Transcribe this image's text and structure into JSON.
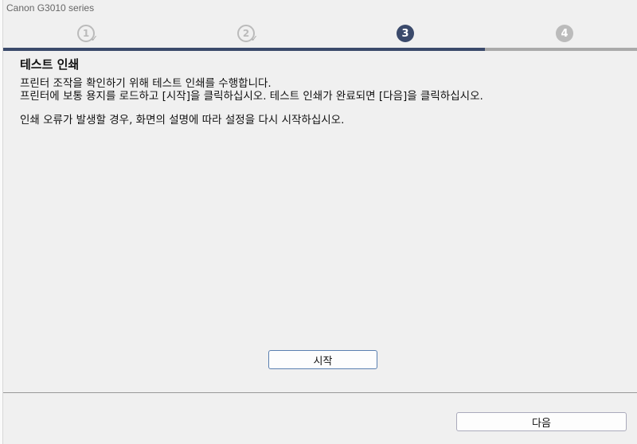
{
  "window": {
    "title": "Canon G3010 series"
  },
  "steps": [
    {
      "label": "1",
      "state": "done"
    },
    {
      "label": "2",
      "state": "done"
    },
    {
      "label": "3",
      "state": "current"
    },
    {
      "label": "4",
      "state": "pending"
    }
  ],
  "progress": {
    "percent": 76
  },
  "colors": {
    "accent": "#3b4a6b",
    "inactive": "#bbbbbb"
  },
  "content": {
    "heading": "테스트 인쇄",
    "line1": "프린터 조작을 확인하기 위해 테스트 인쇄를 수행합니다.",
    "line2": "프린터에 보통 용지를 로드하고 [시작]을 클릭하십시오. 테스트 인쇄가 완료되면 [다음]을 클릭하십시오.",
    "line3": "인쇄 오류가 발생할 경우, 화면의 설명에 따라 설정을 다시 시작하십시오."
  },
  "buttons": {
    "start": "시작",
    "next": "다음"
  }
}
